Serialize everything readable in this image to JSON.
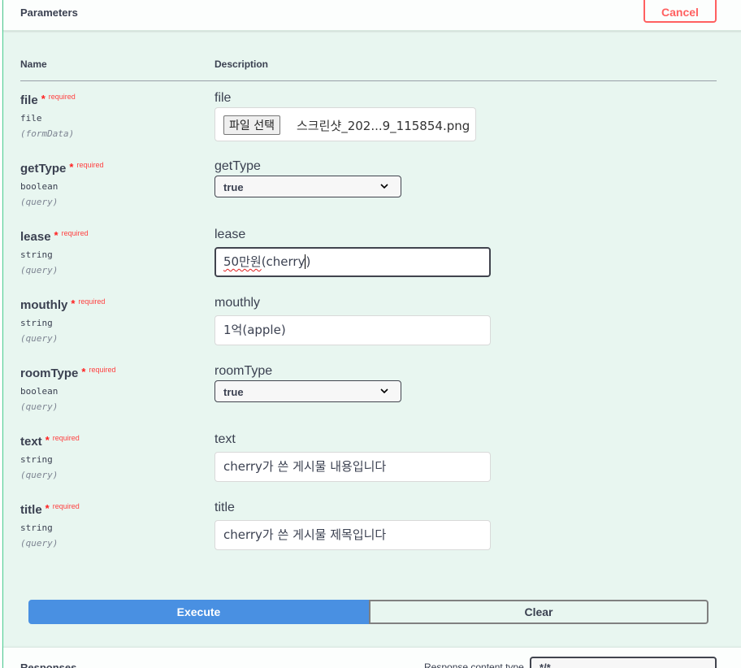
{
  "header": {
    "title": "Parameters",
    "cancel_label": "Cancel"
  },
  "columns": {
    "name": "Name",
    "description": "Description"
  },
  "required_label": "required",
  "params": [
    {
      "name": "file",
      "type": "file",
      "in": "(formData)",
      "description": "file",
      "control": "file",
      "file_button": "파일 선택",
      "file_name": "스크린샷_202...9_115854.png"
    },
    {
      "name": "getType",
      "type": "boolean",
      "in": "(query)",
      "description": "getType",
      "control": "select",
      "value": "true"
    },
    {
      "name": "lease",
      "type": "string",
      "in": "(query)",
      "description": "lease",
      "control": "text",
      "value_underlined": "50만원",
      "value_rest": "(cherry",
      "value_after_caret": ")",
      "focused": true
    },
    {
      "name": "mouthly",
      "type": "string",
      "in": "(query)",
      "description": "mouthly",
      "control": "text",
      "value": "1억(apple)"
    },
    {
      "name": "roomType",
      "type": "boolean",
      "in": "(query)",
      "description": "roomType",
      "control": "select",
      "value": "true"
    },
    {
      "name": "text",
      "type": "string",
      "in": "(query)",
      "description": "text",
      "control": "text",
      "value": "cherry가 쓴 게시물 내용입니다"
    },
    {
      "name": "title",
      "type": "string",
      "in": "(query)",
      "description": "title",
      "control": "text",
      "value": "cherry가 쓴 게시물 제목입니다"
    }
  ],
  "buttons": {
    "execute": "Execute",
    "clear": "Clear"
  },
  "responses": {
    "title": "Responses",
    "content_type_label": "Response content type",
    "content_type_value": "*/*"
  },
  "colors": {
    "accent_green": "#49cc90",
    "execute_blue": "#4990e2",
    "cancel_red": "#ff6060",
    "required_red": "#ff2020"
  },
  "icons": {
    "select_chevron": "chevron-down-icon"
  }
}
